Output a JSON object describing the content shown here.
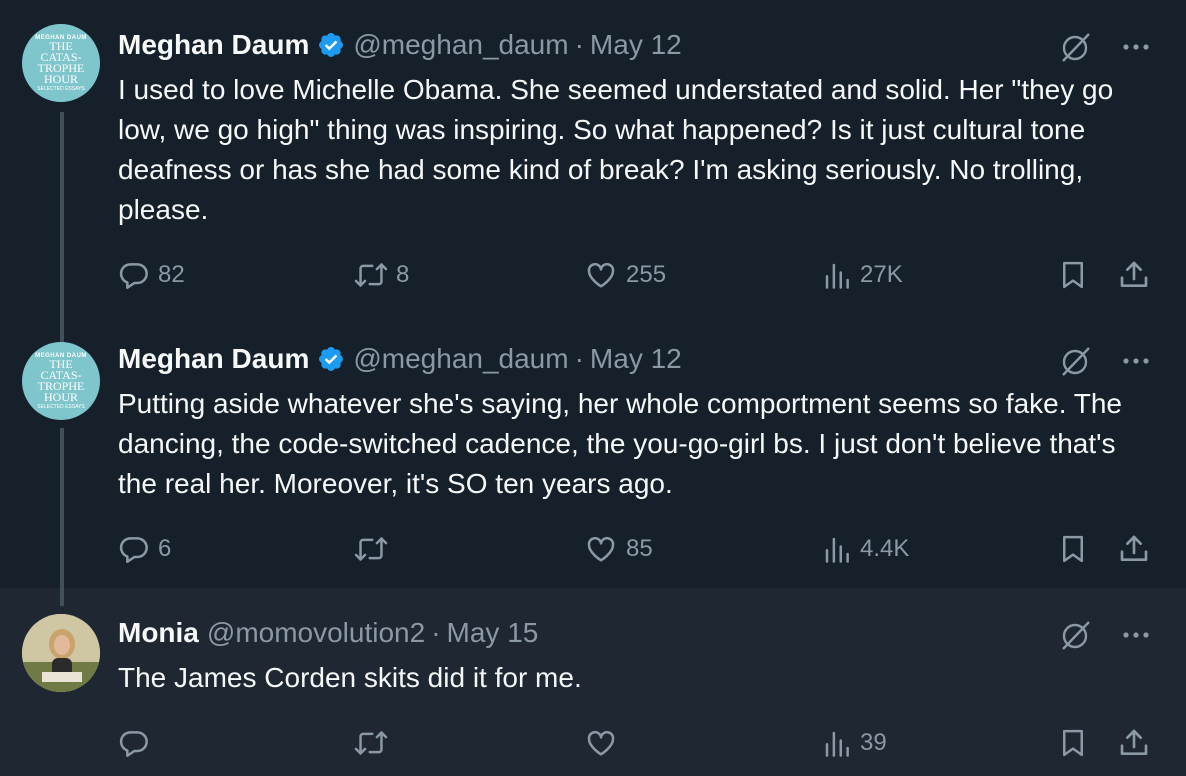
{
  "tweets": [
    {
      "author": "Meghan Daum",
      "handle": "@meghan_daum",
      "separator": "·",
      "date": "May 12",
      "verified": true,
      "avatar": {
        "kicker": "MEGHAN DAUM",
        "lines": [
          "THE",
          "CATAS-",
          "TROPHE",
          "HOUR"
        ],
        "foot": "SELECTED ESSAYS"
      },
      "text": "I used to love Michelle Obama. She seemed understated and solid. Her \"they go low, we go high\" thing was inspiring. So what happened? Is it just cultural tone deafness or has she had some kind of break? I'm asking seriously. No trolling, please.",
      "replies": "82",
      "reposts": "8",
      "likes": "255",
      "views": "27K"
    },
    {
      "author": "Meghan Daum",
      "handle": "@meghan_daum",
      "separator": "·",
      "date": "May 12",
      "verified": true,
      "avatar": {
        "kicker": "MEGHAN DAUM",
        "lines": [
          "THE",
          "CATAS-",
          "TROPHE",
          "HOUR"
        ],
        "foot": "SELECTED ESSAYS"
      },
      "text": "Putting aside whatever she's saying, her whole comportment seems so fake. The dancing, the code-switched cadence, the you-go-girl bs. I just don't believe that's the real her. Moreover, it's SO ten years ago.",
      "replies": "6",
      "reposts": "",
      "likes": "85",
      "views": "4.4K"
    },
    {
      "author": "Monia",
      "handle": "@momovolution2",
      "separator": "·",
      "date": "May 15",
      "verified": false,
      "text": "The James Corden skits did it for me.",
      "replies": "",
      "reposts": "",
      "likes": "",
      "views": "39"
    }
  ],
  "icons": {
    "verified": "verified-badge-icon",
    "grok": "grok-icon",
    "more": "more-icon",
    "reply": "reply-icon",
    "repost": "repost-icon",
    "like": "like-icon",
    "views": "views-icon",
    "bookmark": "bookmark-icon",
    "share": "share-icon"
  },
  "colors": {
    "background": "#15202b",
    "highlighted_background": "#1e2732",
    "text": "#f7f9f9",
    "muted": "#8b98a5",
    "verified": "#1d9bf0",
    "thread_line": "#42505c"
  }
}
